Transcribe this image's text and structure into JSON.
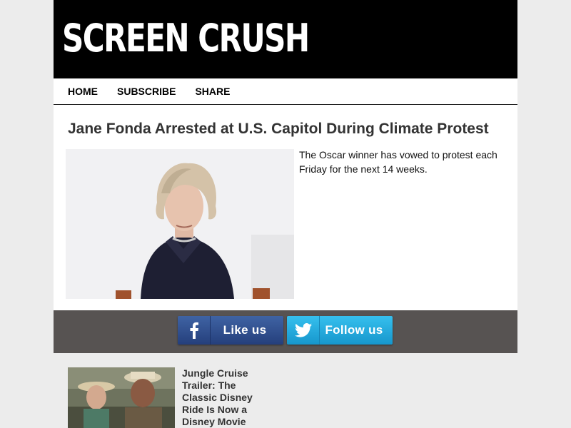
{
  "brand": {
    "logo_text": "SCREEN CRUSH"
  },
  "nav": {
    "items": [
      {
        "label": "HOME"
      },
      {
        "label": "SUBSCRIBE"
      },
      {
        "label": "SHARE"
      }
    ]
  },
  "story": {
    "headline": "Jane Fonda Arrested at U.S. Capitol During Climate Protest",
    "summary": "The Oscar winner has vowed to protest each Friday for the next 14 weeks."
  },
  "social": {
    "facebook": {
      "label": "Like us",
      "icon": "facebook-icon",
      "color": "#3b5998"
    },
    "twitter": {
      "label": "Follow us",
      "icon": "twitter-icon",
      "color": "#1da1f2"
    },
    "bar_color": "#575352"
  },
  "related": {
    "title": "Jungle Cruise Trailer: The Classic Disney Ride Is Now a Disney Movie"
  }
}
